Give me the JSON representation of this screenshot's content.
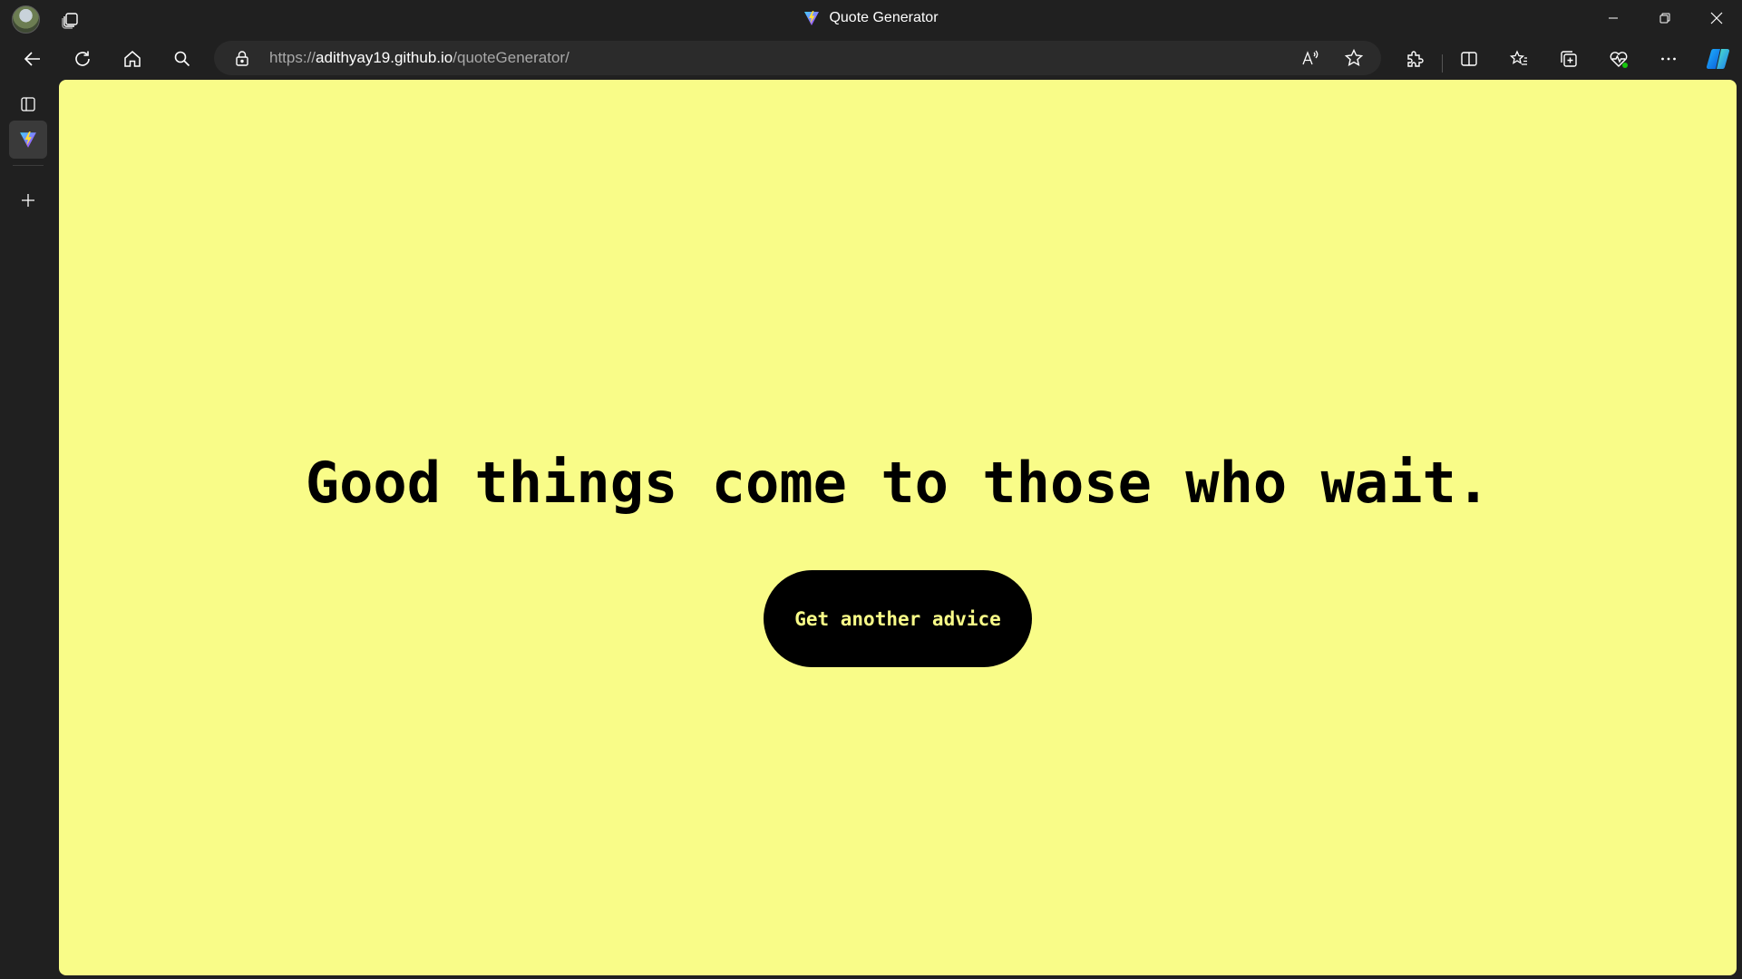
{
  "window": {
    "title": "Quote Generator",
    "favicon": "vite-logo-icon"
  },
  "toolbar": {
    "url_scheme": "https://",
    "url_host": "adithyay19.github.io",
    "url_path": "/quoteGenerator/",
    "icons": [
      "back-arrow-icon",
      "refresh-icon",
      "home-icon",
      "search-icon",
      "lock-icon",
      "read-aloud-icon",
      "favorite-star-icon",
      "extensions-icon",
      "split-screen-icon",
      "favorites-icon",
      "collections-icon",
      "browser-essentials-icon",
      "more-menu-icon",
      "copilot-icon"
    ]
  },
  "page": {
    "quote": "Good things come to those who wait.",
    "button_label": "Get another advice",
    "background_color": "#f9fc88",
    "button_color": "#000000",
    "button_text_color": "#f9fc88"
  }
}
